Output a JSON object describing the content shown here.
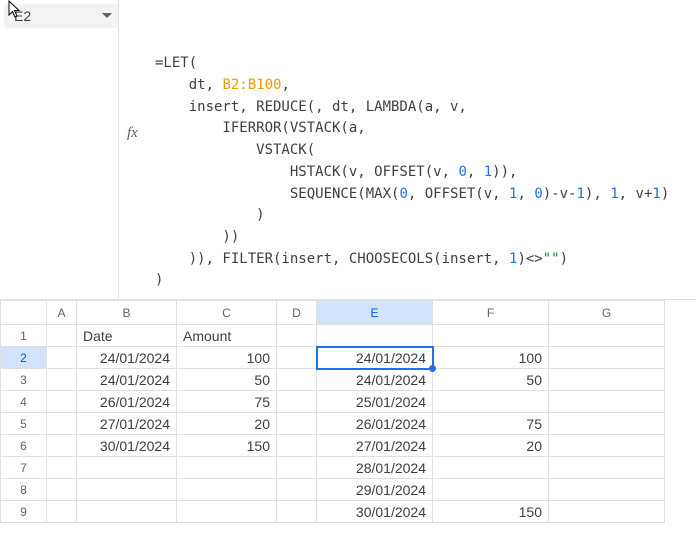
{
  "nameBox": {
    "ref": "E2"
  },
  "formula": {
    "line1_a": "=LET(",
    "line2_a": "    dt, ",
    "line2_range": "B2:B100",
    "line2_b": ",",
    "line3_a": "    insert, REDUCE(, dt, LAMBDA(a, v,",
    "line4_a": "        IFERROR(VSTACK(a,",
    "line5_a": "            VSTACK(",
    "line6_a": "                HSTACK(v, OFFSET(v, ",
    "line6_n1": "0",
    "line6_b": ", ",
    "line6_n2": "1",
    "line6_c": ")),",
    "line7_a": "                SEQUENCE(MAX(",
    "line7_n1": "0",
    "line7_b": ", OFFSET(v, ",
    "line7_n2": "1",
    "line7_c": ", ",
    "line7_n3": "0",
    "line7_d": ")-v-",
    "line7_n4": "1",
    "line7_e": "), ",
    "line7_n5": "1",
    "line7_f": ", v+",
    "line7_n6": "1",
    "line7_g": ")",
    "line8_a": "            )",
    "line9_a": "        ))",
    "line10_a": "    )), FILTER(insert, CHOOSECOLS(insert, ",
    "line10_n1": "1",
    "line10_b": ")<>",
    "line10_str": "\"\"",
    "line10_c": ")",
    "line11_a": ")"
  },
  "fxLabel": "fx",
  "columns": {
    "A": "A",
    "B": "B",
    "C": "C",
    "D": "D",
    "E": "E",
    "F": "F",
    "G": "G"
  },
  "rows": {
    "r1": "1",
    "r2": "2",
    "r3": "3",
    "r4": "4",
    "r5": "5",
    "r6": "6",
    "r7": "7",
    "r8": "8",
    "r9": "9"
  },
  "cells": {
    "B1": "Date",
    "C1": "Amount",
    "B2": "24/01/2024",
    "C2": "100",
    "E2": "24/01/2024",
    "F2": "100",
    "B3": "24/01/2024",
    "C3": "50",
    "E3": "24/01/2024",
    "F3": "50",
    "B4": "26/01/2024",
    "C4": "75",
    "E4": "25/01/2024",
    "B5": "27/01/2024",
    "C5": "20",
    "E5": "26/01/2024",
    "F5": "75",
    "B6": "30/01/2024",
    "C6": "150",
    "E6": "27/01/2024",
    "F6": "20",
    "E7": "28/01/2024",
    "E8": "29/01/2024",
    "E9": "30/01/2024",
    "F9": "150"
  }
}
